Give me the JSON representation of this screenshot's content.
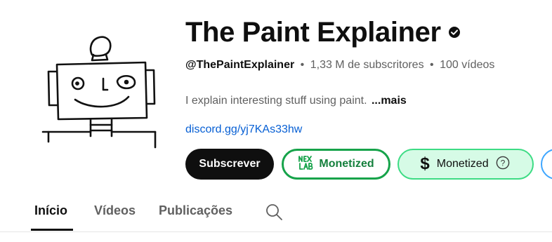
{
  "channel": {
    "title": "The Paint Explainer",
    "handle": "@ThePaintExplainer",
    "subscribers": "1,33 M de subscritores",
    "videos": "100 vídeos",
    "separator": "•",
    "description": "I explain interesting stuff using paint.",
    "more_label": "...mais",
    "link": "discord.gg/yj7KAs33hw",
    "verified_icon": "verified-check-icon"
  },
  "buttons": {
    "subscribe_label": "Subscrever",
    "monetized_primary_label": "Monetized",
    "monetized_primary_logo": "nex-lab-logo",
    "monetized_secondary_label": "Monetized",
    "monetized_secondary_symbol": "$",
    "help_symbol": "?"
  },
  "tabs": {
    "items": [
      {
        "label": "Início",
        "active": true
      },
      {
        "label": "Vídeos",
        "active": false
      },
      {
        "label": "Publicações",
        "active": false
      }
    ],
    "search_icon": "search-icon"
  },
  "colors": {
    "text_primary": "#0f0f0f",
    "text_secondary": "#606060",
    "link": "#065fd4",
    "monetized_green": "#16a34a",
    "monetized_bg": "#d6fbe6"
  }
}
